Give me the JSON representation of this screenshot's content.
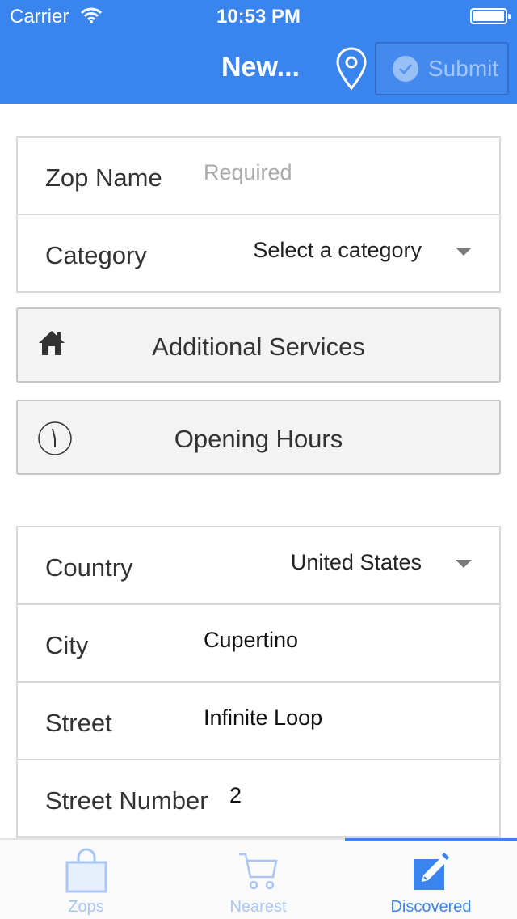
{
  "status_bar": {
    "carrier": "Carrier",
    "time": "10:53 PM"
  },
  "nav": {
    "title": "New...",
    "submit_label": "Submit"
  },
  "form": {
    "zop_name": {
      "label": "Zop Name",
      "placeholder": "Required"
    },
    "category": {
      "label": "Category",
      "value": "Select a category"
    }
  },
  "buttons": {
    "additional_services": "Additional Services",
    "opening_hours": "Opening Hours"
  },
  "address": {
    "country": {
      "label": "Country",
      "value": "United States"
    },
    "city": {
      "label": "City",
      "value": "Cupertino"
    },
    "street": {
      "label": "Street",
      "value": "Infinite Loop"
    },
    "street_number": {
      "label": "Street Number",
      "value": "2"
    }
  },
  "tabbar": {
    "tabs": [
      {
        "label": "Zops",
        "icon": "shopping-bag-icon",
        "active": false
      },
      {
        "label": "Nearest",
        "icon": "shopping-cart-icon",
        "active": false
      },
      {
        "label": "Discovered",
        "icon": "edit-icon",
        "active": true
      }
    ]
  },
  "colors": {
    "accent": "#3a84ee",
    "tab_inactive": "#a9c6f3"
  }
}
